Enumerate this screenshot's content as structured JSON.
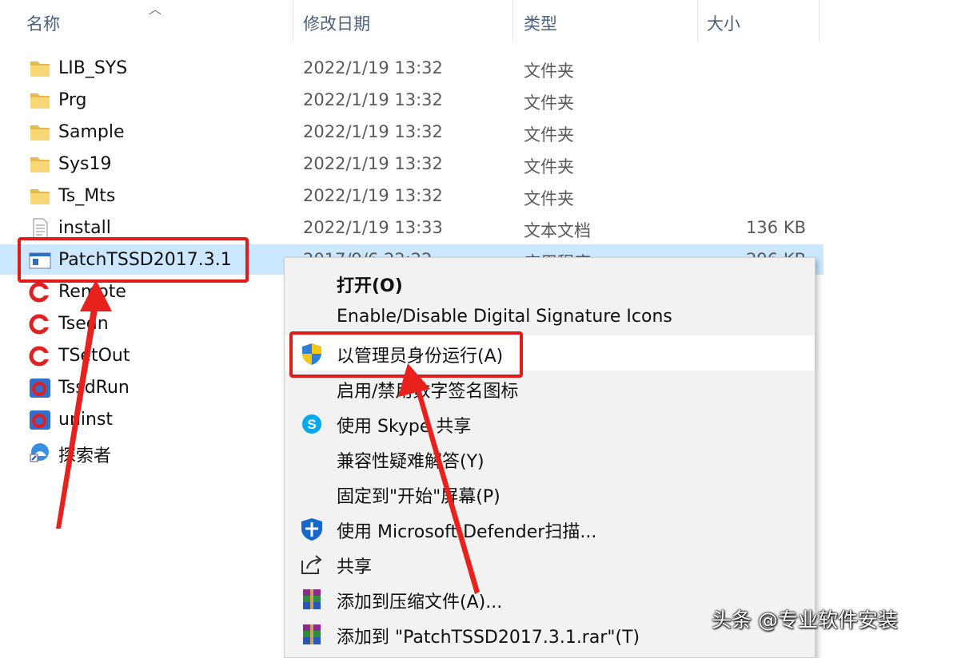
{
  "headers": {
    "name": "名称",
    "date": "修改日期",
    "type": "类型",
    "size": "大小"
  },
  "files": [
    {
      "name": "LIB_SYS",
      "date": "2022/1/19 13:32",
      "type": "文件夹",
      "size": "",
      "icon": "folder-icon"
    },
    {
      "name": "Prg",
      "date": "2022/1/19 13:32",
      "type": "文件夹",
      "size": "",
      "icon": "folder-icon"
    },
    {
      "name": "Sample",
      "date": "2022/1/19 13:32",
      "type": "文件夹",
      "size": "",
      "icon": "folder-icon"
    },
    {
      "name": "Sys19",
      "date": "2022/1/19 13:32",
      "type": "文件夹",
      "size": "",
      "icon": "folder-icon"
    },
    {
      "name": "Ts_Mts",
      "date": "2022/1/19 13:32",
      "type": "文件夹",
      "size": "",
      "icon": "folder-icon"
    },
    {
      "name": "install",
      "date": "2022/1/19 13:33",
      "type": "文本文档",
      "size": "136 KB",
      "icon": "text-file-icon"
    },
    {
      "name": "PatchTSSD2017.3.1",
      "date": "2017/9/6 22:22",
      "type": "应用程序",
      "size": "296 KB",
      "icon": "exe-icon",
      "selected": true
    },
    {
      "name": "Remote",
      "date": "",
      "type": "",
      "size": "",
      "icon": "tssd-app-icon"
    },
    {
      "name": "Tsedn",
      "date": "",
      "type": "",
      "size": "",
      "icon": "tssd-app-icon"
    },
    {
      "name": "TSetOut",
      "date": "",
      "type": "",
      "size": "",
      "icon": "tssd-app-icon"
    },
    {
      "name": "TssdRun",
      "date": "",
      "type": "",
      "size": "",
      "icon": "tssd-run-icon"
    },
    {
      "name": "uninst",
      "date": "",
      "type": "",
      "size": "",
      "icon": "tssd-run-icon"
    },
    {
      "name": "探索者",
      "date": "",
      "type": "",
      "size": "",
      "icon": "shortcut-icon"
    }
  ],
  "menu": [
    {
      "label": "打开(O)",
      "icon": "",
      "bold": true
    },
    {
      "label": "Enable/Disable Digital Signature Icons",
      "icon": ""
    },
    {
      "label": "以管理员身份运行(A)",
      "icon": "uac-shield-icon",
      "highlighted": true
    },
    {
      "label": "启用/禁用数字签名图标",
      "icon": ""
    },
    {
      "label": "使用 Skype 共享",
      "icon": "skype-icon"
    },
    {
      "label": "兼容性疑难解答(Y)",
      "icon": ""
    },
    {
      "label": "固定到\"开始\"屏幕(P)",
      "icon": ""
    },
    {
      "label": "使用 Microsoft Defender扫描...",
      "icon": "defender-icon"
    },
    {
      "label": "共享",
      "icon": "share-icon"
    },
    {
      "label": "添加到压缩文件(A)...",
      "icon": "winrar-icon"
    },
    {
      "label": "添加到 \"PatchTSSD2017.3.1.rar\"(T)",
      "icon": "winrar-icon"
    }
  ],
  "watermark": "头条 @专业软件安装",
  "colors": {
    "highlight_red": "#e11b1b",
    "selection": "#cce8ff",
    "folder": "#f8d775",
    "header_text": "#4c607a"
  }
}
